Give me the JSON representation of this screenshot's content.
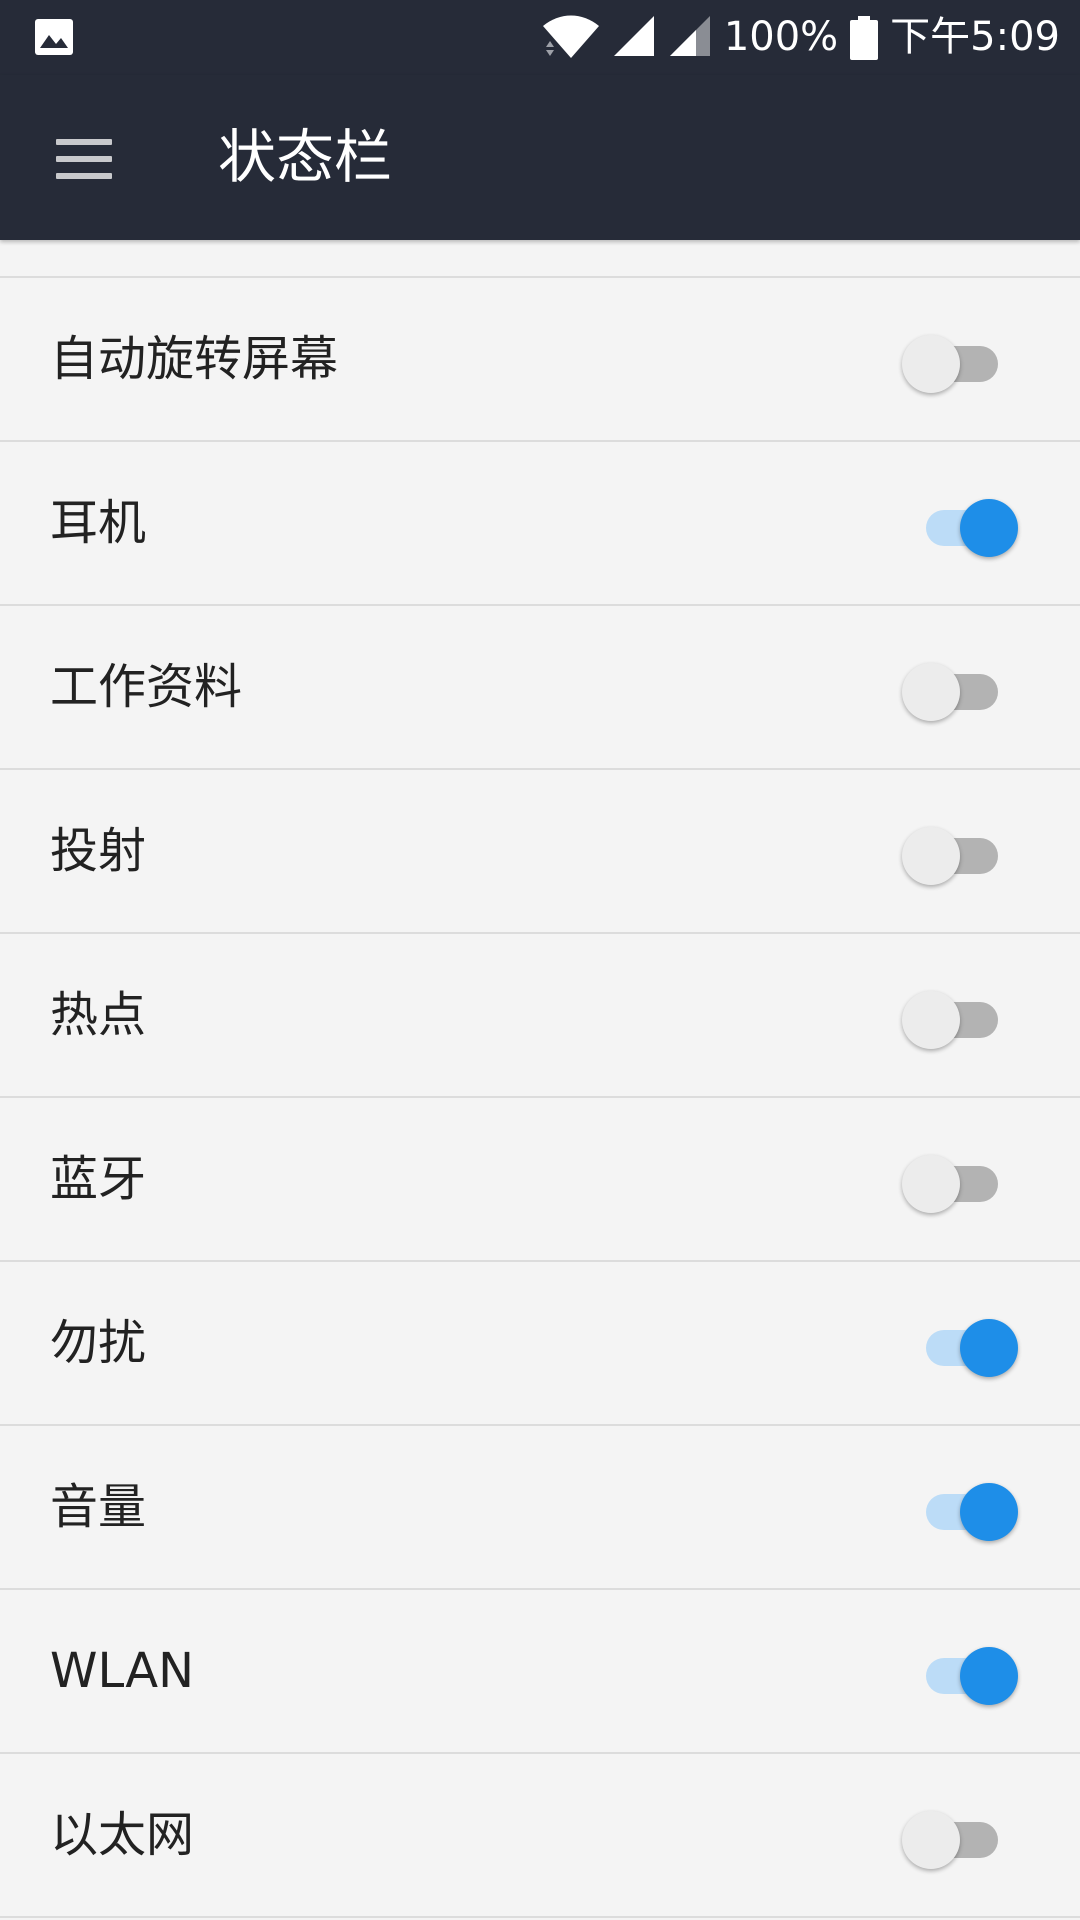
{
  "status_bar": {
    "left_icon": "image-icon",
    "battery_text": "100%",
    "time_text": "下午5:09",
    "icons": [
      "wifi-icon",
      "signal-icon",
      "signal-icon",
      "battery-icon"
    ]
  },
  "app_bar": {
    "menu_icon": "menu-icon",
    "title": "状态栏"
  },
  "colors": {
    "header_bg": "#262b38",
    "page_bg": "#f4f4f4",
    "toggle_on": "#1e8ee8",
    "toggle_off_track": "#b3b3b3",
    "divider": "#dcdcdc"
  },
  "settings": {
    "items": [
      {
        "label": "自动旋转屏幕",
        "enabled": false
      },
      {
        "label": "耳机",
        "enabled": true
      },
      {
        "label": "工作资料",
        "enabled": false
      },
      {
        "label": "投射",
        "enabled": false
      },
      {
        "label": "热点",
        "enabled": false
      },
      {
        "label": "蓝牙",
        "enabled": false
      },
      {
        "label": "勿扰",
        "enabled": true
      },
      {
        "label": "音量",
        "enabled": true
      },
      {
        "label": "WLAN",
        "enabled": true
      },
      {
        "label": "以太网",
        "enabled": false
      }
    ]
  }
}
